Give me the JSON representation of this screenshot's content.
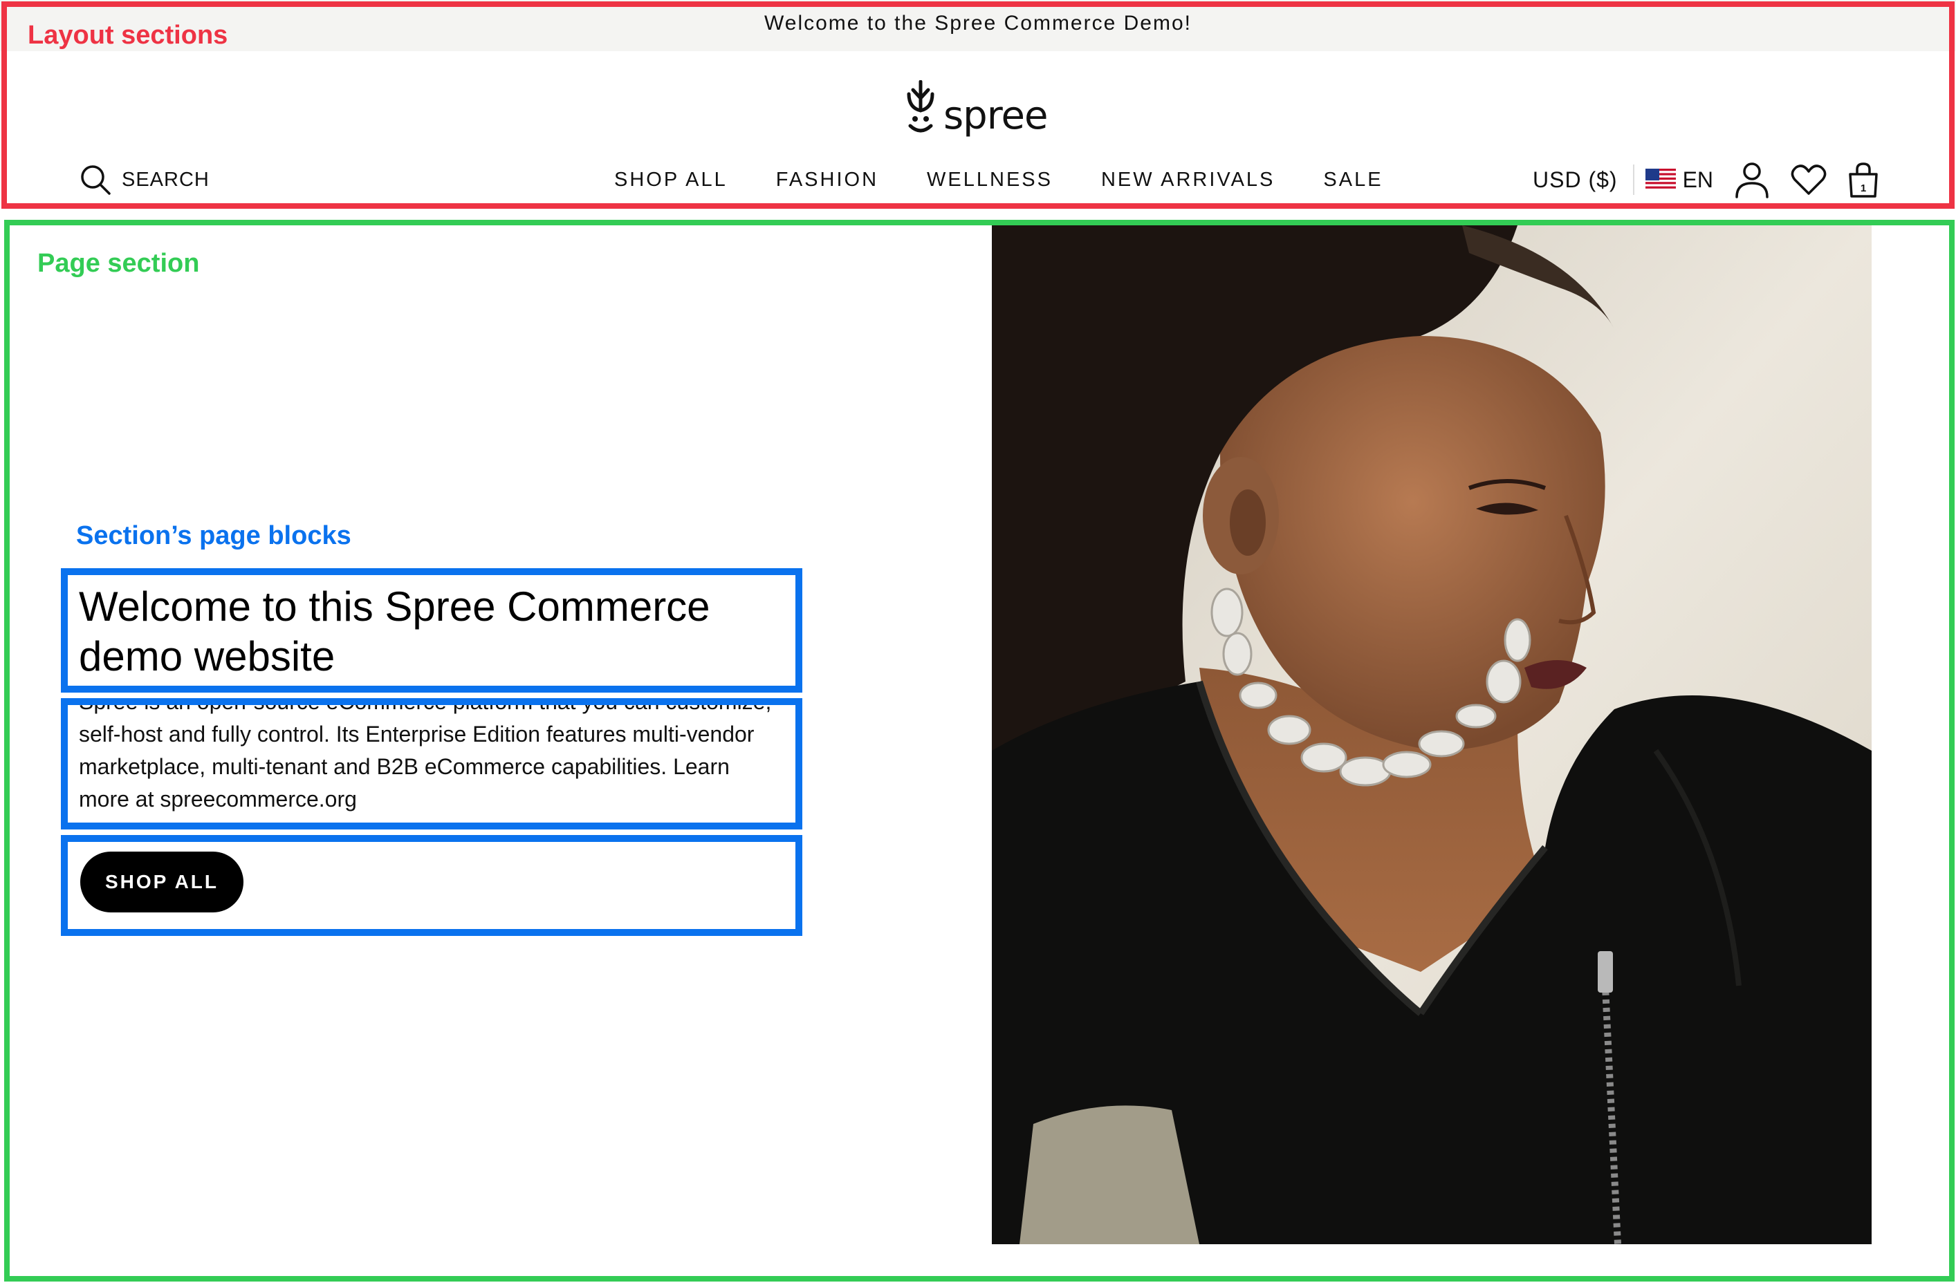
{
  "annotations": {
    "layout_label": "Layout sections",
    "page_label": "Page section",
    "blocks_label": "Section’s page blocks"
  },
  "header": {
    "announcement": "Welcome to the Spree Commerce Demo!",
    "logo_text": "spree",
    "search_label": "SEARCH",
    "nav": [
      "SHOP ALL",
      "FASHION",
      "WELLNESS",
      "NEW ARRIVALS",
      "SALE"
    ],
    "currency": "USD ($)",
    "language": "EN",
    "icons": [
      "search-icon",
      "flag-us-icon",
      "account-icon",
      "wishlist-heart-icon",
      "cart-bag-icon"
    ],
    "cart_count": "1"
  },
  "hero": {
    "title": "Welcome to this Spree Commerce demo website",
    "description": "Spree is an open-source eCommerce platform that you can customize, self-host and fully control. Its Enterprise Edition features multi-vendor marketplace, multi-tenant and B2B eCommerce capabilities. Learn more at spreecommerce.org",
    "button_label": "SHOP ALL"
  },
  "colors": {
    "layout_outline": "#ee3344",
    "page_outline": "#33cc55",
    "block_outline": "#0a72ee",
    "button_bg": "#000000",
    "announcement_bg": "#f4f4f2"
  }
}
